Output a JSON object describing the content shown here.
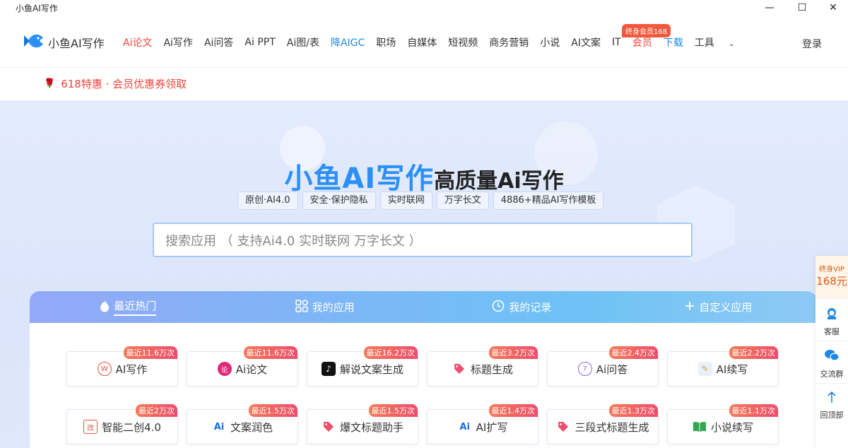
{
  "window": {
    "title": "小鱼AI写作",
    "minimize": "—",
    "maximize": "☐",
    "close": "✕"
  },
  "header": {
    "logo_text": "小鱼AI写作",
    "nav": [
      "Ai论文",
      "Ai写作",
      "Ai问答",
      "Ai PPT",
      "Ai图/表",
      "降AIGC",
      "职场",
      "自媒体",
      "短视频",
      "商务营销",
      "小说",
      "AI文案",
      "IT",
      "会员",
      "下载",
      "工具"
    ],
    "badge": "终身会员168",
    "login": "登录"
  },
  "promo": {
    "text": "618特惠 · 会员优惠券领取"
  },
  "hero": {
    "title": "小鱼AI写作",
    "subtitle": "高质量Ai写作",
    "tags": [
      "原创·AI4.0",
      "安全·保护隐私",
      "实时联网",
      "万字长文",
      "4886+精品AI写作模板"
    ],
    "search_placeholder": "搜索应用 （ 支持Ai4.0 实时联网 万字长文 ）"
  },
  "tabs": [
    {
      "label": "最近热门",
      "icon": "flame-icon"
    },
    {
      "label": "我的应用",
      "icon": "grid-icon"
    },
    {
      "label": "我的记录",
      "icon": "clock-icon"
    },
    {
      "label": "自定义应用",
      "icon": "plus-icon"
    }
  ],
  "cards": [
    {
      "label": "AI写作",
      "hot": "最近11.6万次",
      "icon": "writing-icon"
    },
    {
      "label": "Ai论文",
      "hot": "最近11.6万次",
      "icon": "thesis-icon"
    },
    {
      "label": "解说文案生成",
      "hot": "最近16.2万次",
      "icon": "tiktok-icon"
    },
    {
      "label": "标题生成",
      "hot": "最近3.2万次",
      "icon": "tag-icon"
    },
    {
      "label": "Ai问答",
      "hot": "最近2.4万次",
      "icon": "qa-icon"
    },
    {
      "label": "AI续写",
      "hot": "最近2.2万次",
      "icon": "continue-icon"
    },
    {
      "label": "智能二创4.0",
      "hot": "最近2万次",
      "icon": "rewrite-icon"
    },
    {
      "label": "文案润色",
      "hot": "最近1.5万次",
      "icon": "ai-sparkle-icon"
    },
    {
      "label": "爆文标题助手",
      "hot": "最近1.5万次",
      "icon": "tag-icon"
    },
    {
      "label": "AI扩写",
      "hot": "最近1.4万次",
      "icon": "ai-sparkle-icon"
    },
    {
      "label": "三段式标题生成",
      "hot": "最近1.3万次",
      "icon": "tag-icon"
    },
    {
      "label": "小说续写",
      "hot": "最近1.1万次",
      "icon": "book-icon"
    }
  ],
  "float": {
    "vip_line1": "终身VIP",
    "vip_line2": "168元",
    "items": [
      "客服",
      "交流群",
      "回顶部"
    ]
  },
  "colors": {
    "accent_blue": "#2b8ff5",
    "accent_red": "#f5433b",
    "hot_badge": "#ee4d6b"
  }
}
